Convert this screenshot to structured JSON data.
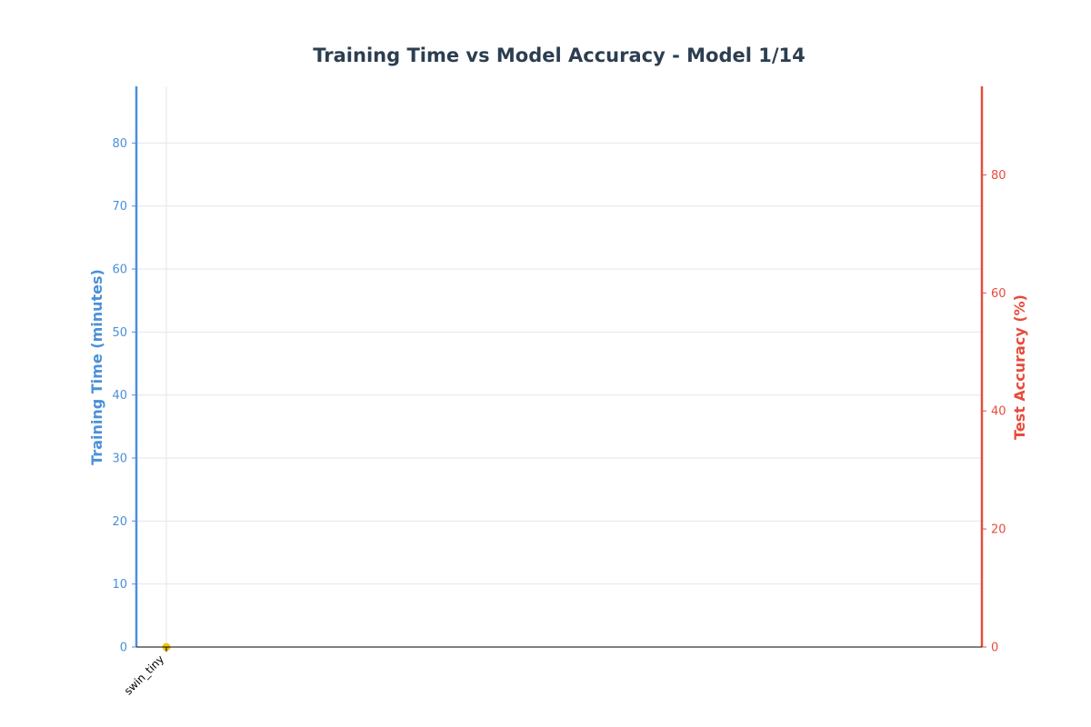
{
  "chart_data": {
    "type": "bar",
    "title": "Training Time vs Model Accuracy - Model 1/14",
    "xlabel": "",
    "categories": [
      "swin_tiny"
    ],
    "y_left": {
      "label": "Training Time (minutes)",
      "ylim": [
        0,
        89
      ],
      "ticks": [
        0,
        10,
        20,
        30,
        40,
        50,
        60,
        70,
        80
      ],
      "color": "#4a90d9"
    },
    "y_right": {
      "label": "Test Accuracy (%)",
      "ylim": [
        0,
        95
      ],
      "ticks": [
        0,
        20,
        40,
        60,
        80
      ],
      "color": "#e74c3c"
    },
    "series": [
      {
        "values": [
          0
        ],
        "axis": "left",
        "type": "bar",
        "color": "#4a90d9"
      },
      {
        "values": [
          0
        ],
        "axis": "right",
        "type": "point",
        "color": "#f1c40f"
      }
    ],
    "grid": true,
    "legend": "none"
  }
}
